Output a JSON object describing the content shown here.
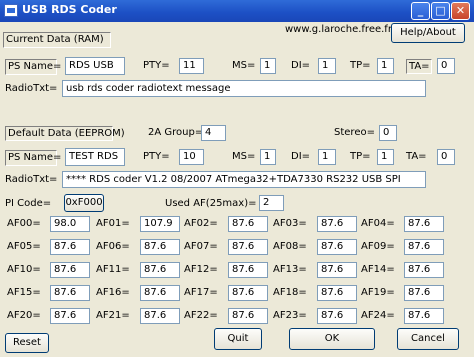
{
  "window": {
    "title": "USB RDS Coder",
    "buttons": {
      "minimize": "_",
      "maximize": "□",
      "close": "✕"
    }
  },
  "header": {
    "url": "www.g.laroche.free.fr",
    "help_label": "Help/About"
  },
  "current": {
    "section_label": "Current Data (RAM)",
    "ps_label": "PS Name=",
    "ps_value": "RDS USB",
    "pty_label": "PTY=",
    "pty_value": "11",
    "ms_label": "MS=",
    "ms_value": "1",
    "di_label": "DI=",
    "di_value": "1",
    "tp_label": "TP=",
    "tp_value": "1",
    "ta_label": "TA=",
    "ta_value": "0",
    "radiotxt_label": "RadioTxt=",
    "radiotxt_value": "usb rds coder radiotext message"
  },
  "default": {
    "section_label": "Default Data (EEPROM)",
    "group_label": "2A Group=",
    "group_value": "4",
    "stereo_label": "Stereo=",
    "stereo_value": "0",
    "ps_label": "PS Name=",
    "ps_value": "TEST RDS",
    "pty_label": "PTY=",
    "pty_value": "10",
    "ms_label": "MS=",
    "ms_value": "1",
    "di_label": "DI=",
    "di_value": "1",
    "tp_label": "TP=",
    "tp_value": "1",
    "ta_label": "TA=",
    "ta_value": "0",
    "radiotxt_label": "RadioTxt=",
    "radiotxt_value": "**** RDS coder V1.2 08/2007 ATmega32+TDA7330 RS232 USB SPI",
    "pi_label": "PI Code=",
    "pi_value": "0xF000",
    "usedaf_label": "Used AF(25max)=",
    "usedaf_value": "2"
  },
  "af": {
    "labels": [
      "AF00=",
      "AF01=",
      "AF02=",
      "AF03=",
      "AF04=",
      "AF05=",
      "AF06=",
      "AF07=",
      "AF08=",
      "AF09=",
      "AF10=",
      "AF11=",
      "AF12=",
      "AF13=",
      "AF14=",
      "AF15=",
      "AF16=",
      "AF17=",
      "AF18=",
      "AF19=",
      "AF20=",
      "AF21=",
      "AF22=",
      "AF23=",
      "AF24="
    ],
    "values": [
      "98.0",
      "107.9",
      "87.6",
      "87.6",
      "87.6",
      "87.6",
      "87.6",
      "87.6",
      "87.6",
      "87.6",
      "87.6",
      "87.6",
      "87.6",
      "87.6",
      "87.6",
      "87.6",
      "87.6",
      "87.6",
      "87.6",
      "87.6",
      "87.6",
      "87.6",
      "87.6",
      "87.6",
      "87.6"
    ]
  },
  "footer": {
    "reset_label": "Reset",
    "quit_label": "Quit",
    "ok_label": "OK",
    "cancel_label": "Cancel"
  }
}
